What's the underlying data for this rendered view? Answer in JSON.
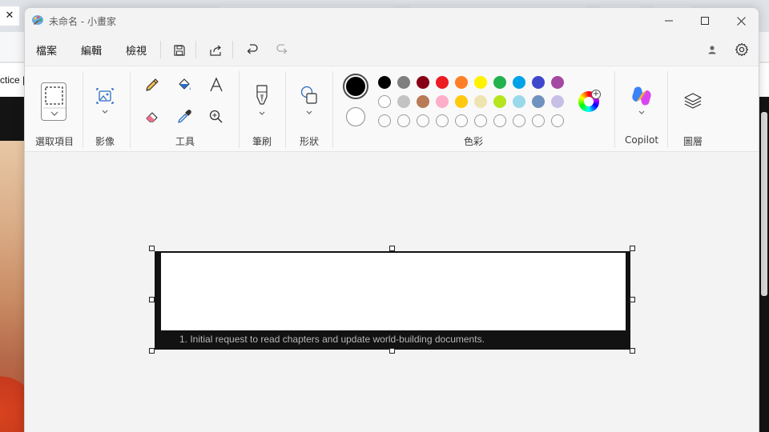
{
  "background": {
    "close_tab_glyph": "✕",
    "page_word": "ctice |"
  },
  "window": {
    "title": "未命名 - 小畫家"
  },
  "menu": {
    "file": "檔案",
    "edit": "編輯",
    "view": "檢視"
  },
  "ribbon": {
    "groups": {
      "select": "選取項目",
      "image": "影像",
      "tools": "工具",
      "brushes": "筆刷",
      "shapes": "形狀",
      "colors": "色彩",
      "copilot": "Copilot",
      "layers": "圖層"
    },
    "current_color": "#000000",
    "secondary_color": "#ffffff",
    "palette_row1": [
      "#000000",
      "#7f7f7f",
      "#880015",
      "#ed1c24",
      "#ff7f27",
      "#fff200",
      "#22b14c",
      "#00a2e8",
      "#3f48cc",
      "#a349a4"
    ],
    "palette_row2": [
      "#ffffff",
      "#c3c3c3",
      "#b97a57",
      "#ffaec9",
      "#ffc90e",
      "#efe4b0",
      "#b5e61d",
      "#99d9ea",
      "#7092be",
      "#c8bfe7"
    ],
    "custom_slots": 10,
    "color_plus": "+"
  },
  "canvas": {
    "caption": "1.  Initial request to read chapters and update world-building documents."
  }
}
